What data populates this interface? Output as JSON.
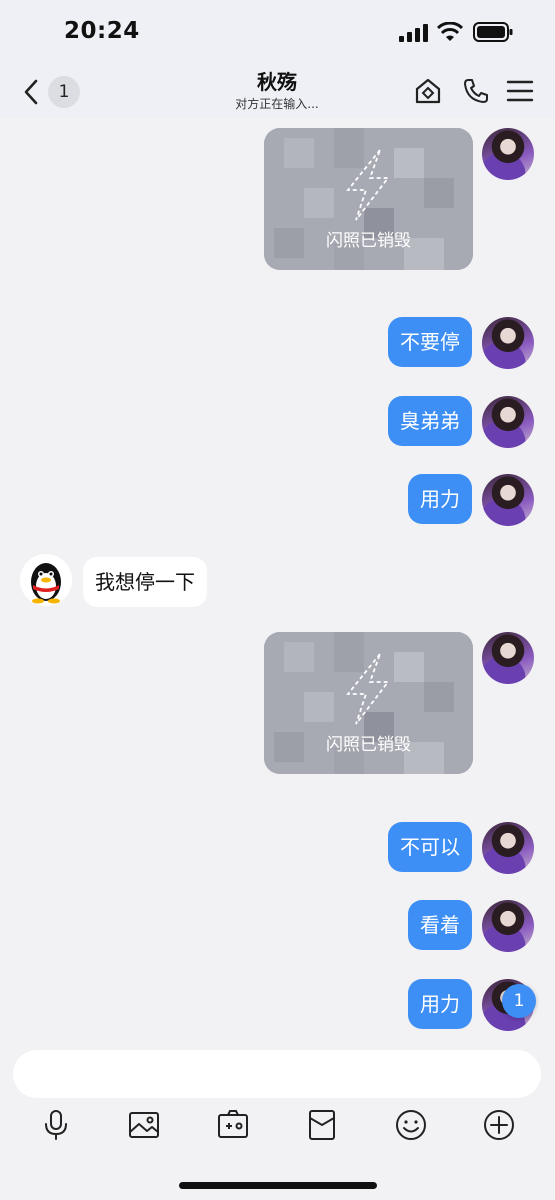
{
  "status_bar": {
    "time": "20:24"
  },
  "nav": {
    "back_badge": "1",
    "title": "秋殇",
    "subtitle": "对方正在输入..."
  },
  "messages": [
    {
      "type": "flash_photo",
      "from": "self",
      "label": "闪照已销毁"
    },
    {
      "type": "text",
      "from": "self",
      "text": "不要停"
    },
    {
      "type": "text",
      "from": "self",
      "text": "臭弟弟"
    },
    {
      "type": "text",
      "from": "self",
      "text": "用力"
    },
    {
      "type": "text",
      "from": "peer",
      "text": "我想停一下"
    },
    {
      "type": "flash_photo",
      "from": "self",
      "label": "闪照已销毁"
    },
    {
      "type": "text",
      "from": "self",
      "text": "不可以"
    },
    {
      "type": "text",
      "from": "self",
      "text": "看着"
    },
    {
      "type": "text",
      "from": "self",
      "text": "用力"
    }
  ],
  "unread_badge": "1",
  "input": {
    "value": "",
    "placeholder": ""
  },
  "toolbar": {
    "icons": [
      "microphone-icon",
      "image-icon",
      "camera-icon",
      "red-packet-icon",
      "emoji-icon",
      "plus-icon"
    ]
  },
  "colors": {
    "accent": "#3d8ff5",
    "background": "#f2f2f4",
    "bubble_in": "#ffffff"
  }
}
